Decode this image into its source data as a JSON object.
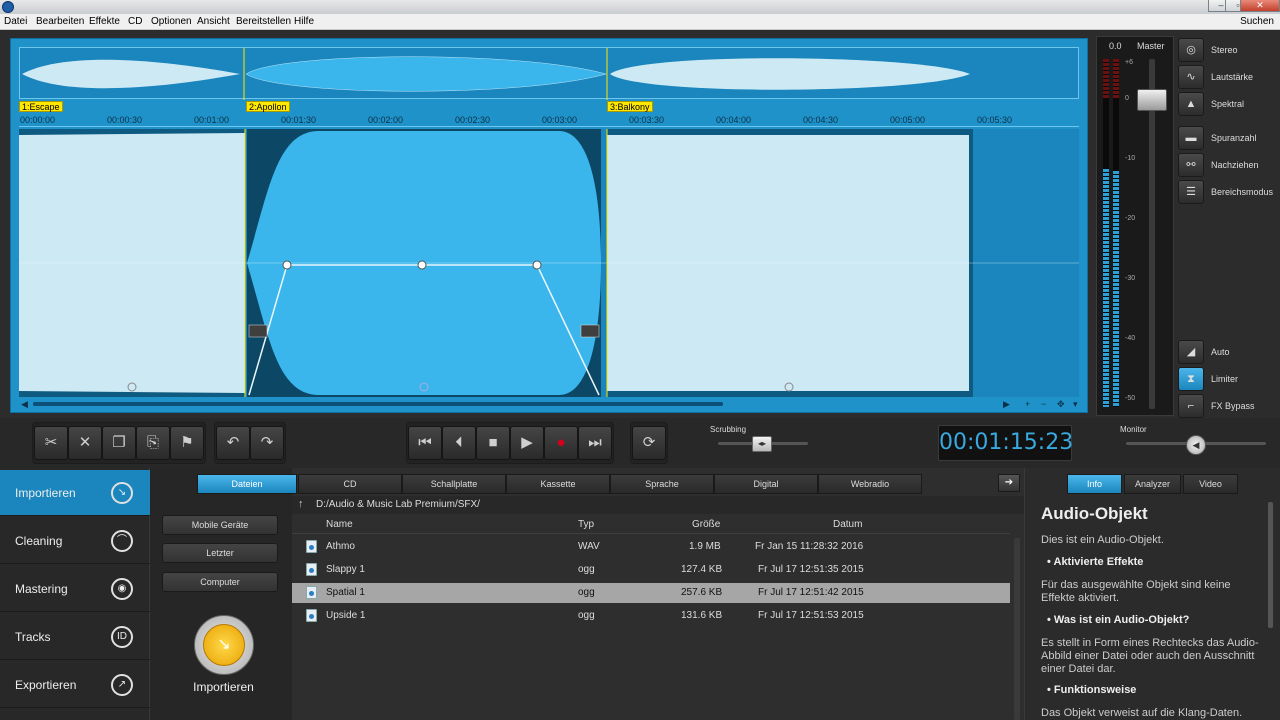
{
  "menu": [
    "Datei",
    "Bearbeiten",
    "Effekte",
    "CD",
    "Optionen",
    "Ansicht",
    "Bereitstellen",
    "Hilfe"
  ],
  "menu_search": "Suchen",
  "window_buttons": [
    "–",
    "▫",
    "✕"
  ],
  "markers": [
    "1:Escape",
    "2:Apollon",
    "3:Balkony"
  ],
  "ruler": [
    "00:00:00",
    "00:00:30",
    "00:01:00",
    "00:01:30",
    "00:02:00",
    "00:02:30",
    "00:03:00",
    "00:03:30",
    "00:04:00",
    "00:04:30",
    "00:05:00",
    "00:05:30"
  ],
  "mixer": {
    "value": "0.0",
    "label": "Master",
    "db": [
      "+6",
      "0",
      "-10",
      "-20",
      "-30",
      "-40",
      "-50"
    ]
  },
  "right_buttons": {
    "stereo": "Stereo",
    "lautstaerke": "Lautstärke",
    "spektral": "Spektral",
    "spuranzahl": "Spuranzahl",
    "nachziehen": "Nachziehen",
    "bereichsmodus": "Bereichsmodus",
    "auto": "Auto",
    "limiter": "Limiter",
    "fxbypass": "FX Bypass"
  },
  "transport": {
    "scrubbing": "Scrubbing",
    "timecode": "00:01:15:23",
    "monitor": "Monitor"
  },
  "nav": [
    "Importieren",
    "Cleaning",
    "Mastering",
    "Tracks",
    "Exportieren"
  ],
  "sources": [
    "Mobile Geräte",
    "Letzter",
    "Computer"
  ],
  "import_label": "Importieren",
  "tabs": [
    "Dateien",
    "CD",
    "Schallplatte",
    "Kassette",
    "Sprache",
    "Digital",
    "Webradio"
  ],
  "path": "D:/Audio & Music Lab Premium/SFX/",
  "file_headers": {
    "name": "Name",
    "typ": "Typ",
    "size": "Größe",
    "date": "Datum"
  },
  "files": [
    {
      "name": "Athmo",
      "typ": "WAV",
      "size": "1.9 MB",
      "date": "Fr Jan 15 11:28:32 2016"
    },
    {
      "name": "Slappy 1",
      "typ": "ogg",
      "size": "127.4 KB",
      "date": "Fr Jul 17 12:51:35 2015"
    },
    {
      "name": "Spatial 1",
      "typ": "ogg",
      "size": "257.6 KB",
      "date": "Fr Jul 17 12:51:42 2015"
    },
    {
      "name": "Upside 1",
      "typ": "ogg",
      "size": "131.6 KB",
      "date": "Fr Jul 17 12:51:53 2015"
    }
  ],
  "info": {
    "tabs": [
      "Info",
      "Analyzer",
      "Video"
    ],
    "title": "Audio-Objekt",
    "intro": "Dies ist ein Audio-Objekt.",
    "h1": "• Aktivierte Effekte",
    "p1": "Für das ausgewählte Objekt sind keine Effekte aktiviert.",
    "h2": "• Was ist ein Audio-Objekt?",
    "p2": "Es stellt in Form eines Rechtecks das Audio-Abbild einer Datei oder auch den Ausschnitt einer Datei dar.",
    "h3": "• Funktionsweise",
    "p3": "Das Objekt verweist auf die Klang-Daten."
  },
  "colors": {
    "accent": "#1a86bd",
    "wave_light": "#cde9f4",
    "wave_selected": "#3ab6ec",
    "marker": "#ffe800"
  }
}
